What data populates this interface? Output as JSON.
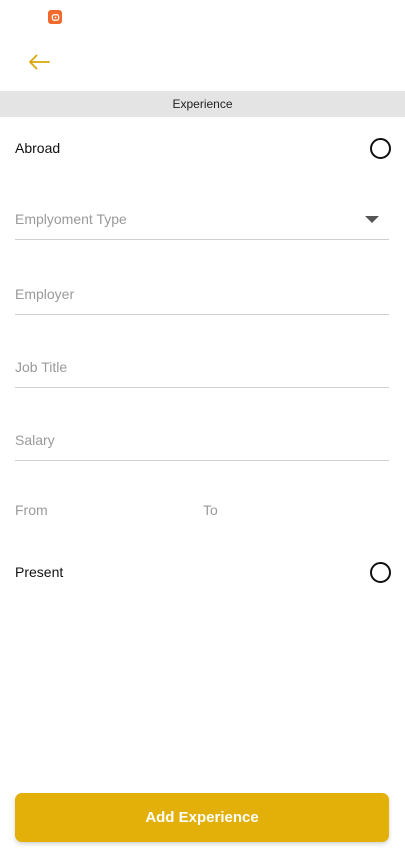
{
  "colors": {
    "accent": "#e2b008",
    "header_bg": "#e4e4e4",
    "placeholder": "#9a9a9a",
    "notification_icon": "#f06a2c"
  },
  "status_bar": {
    "notification_icon": "app-notification-icon"
  },
  "toolbar": {
    "back_icon": "arrow-left-icon"
  },
  "section": {
    "title": "Experience"
  },
  "form": {
    "abroad_label": "Abroad",
    "employment_type_placeholder": "Emplyoment Type",
    "employer_placeholder": "Employer",
    "job_title_placeholder": "Job Title",
    "salary_placeholder": "Salary",
    "from_placeholder": "From",
    "to_placeholder": "To",
    "present_label": "Present"
  },
  "actions": {
    "add_label": "Add Experience"
  }
}
